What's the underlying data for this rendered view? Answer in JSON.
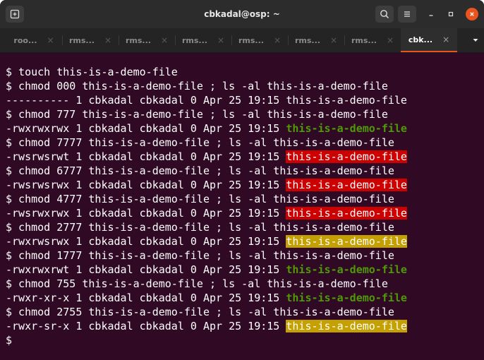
{
  "window": {
    "title": "cbkadal@osp: ~"
  },
  "tabs": [
    {
      "label": "roo...",
      "active": false
    },
    {
      "label": "rms...",
      "active": false
    },
    {
      "label": "rms...",
      "active": false
    },
    {
      "label": "rms...",
      "active": false
    },
    {
      "label": "rms...",
      "active": false
    },
    {
      "label": "rms...",
      "active": false
    },
    {
      "label": "rms...",
      "active": false
    },
    {
      "label": "cbk...",
      "active": true
    }
  ],
  "tab_close_glyph": "×",
  "icons": {
    "new_tab": "new-tab-icon",
    "search": "search-icon",
    "menu": "hamburger-menu-icon",
    "minimize": "minimize-icon",
    "maximize": "maximize-icon",
    "close": "close-icon",
    "tab_list": "chevron-down-icon"
  },
  "colors": {
    "terminal_bg": "#300a24",
    "titlebar_bg": "#2c2c2c",
    "tabbar_bg": "#242424",
    "close_button": "#e95420",
    "exec_file_green": "#4e9a06",
    "setuid_red_bg": "#cc0000",
    "setgid_yellow_bg": "#c4a000"
  },
  "terminal": {
    "lines": [
      [
        {
          "text": "$ touch this-is-a-demo-file",
          "style": "plain"
        }
      ],
      [
        {
          "text": "$ chmod 000 this-is-a-demo-file ; ls -al this-is-a-demo-file",
          "style": "plain"
        }
      ],
      [
        {
          "text": "---------- 1 cbkadal cbkadal 0 Apr 25 19:15 this-is-a-demo-file",
          "style": "plain"
        }
      ],
      [
        {
          "text": "$ chmod 777 this-is-a-demo-file ; ls -al this-is-a-demo-file",
          "style": "plain"
        }
      ],
      [
        {
          "text": "-rwxrwxrwx 1 cbkadal cbkadal 0 Apr 25 19:15 ",
          "style": "plain"
        },
        {
          "text": "this-is-a-demo-file",
          "style": "green"
        }
      ],
      [
        {
          "text": "$ chmod 7777 this-is-a-demo-file ; ls -al this-is-a-demo-file",
          "style": "plain"
        }
      ],
      [
        {
          "text": "-rwsrwsrwt 1 cbkadal cbkadal 0 Apr 25 19:15 ",
          "style": "plain"
        },
        {
          "text": "this-is-a-demo-file",
          "style": "red"
        }
      ],
      [
        {
          "text": "$ chmod 6777 this-is-a-demo-file ; ls -al this-is-a-demo-file",
          "style": "plain"
        }
      ],
      [
        {
          "text": "-rwsrwsrwx 1 cbkadal cbkadal 0 Apr 25 19:15 ",
          "style": "plain"
        },
        {
          "text": "this-is-a-demo-file",
          "style": "red"
        }
      ],
      [
        {
          "text": "$ chmod 4777 this-is-a-demo-file ; ls -al this-is-a-demo-file",
          "style": "plain"
        }
      ],
      [
        {
          "text": "-rwsrwxrwx 1 cbkadal cbkadal 0 Apr 25 19:15 ",
          "style": "plain"
        },
        {
          "text": "this-is-a-demo-file",
          "style": "red"
        }
      ],
      [
        {
          "text": "$ chmod 2777 this-is-a-demo-file ; ls -al this-is-a-demo-file",
          "style": "plain"
        }
      ],
      [
        {
          "text": "-rwxrwsrwx 1 cbkadal cbkadal 0 Apr 25 19:15 ",
          "style": "plain"
        },
        {
          "text": "this-is-a-demo-file",
          "style": "yellow"
        }
      ],
      [
        {
          "text": "$ chmod 1777 this-is-a-demo-file ; ls -al this-is-a-demo-file",
          "style": "plain"
        }
      ],
      [
        {
          "text": "-rwxrwxrwt 1 cbkadal cbkadal 0 Apr 25 19:15 ",
          "style": "plain"
        },
        {
          "text": "this-is-a-demo-file",
          "style": "green"
        }
      ],
      [
        {
          "text": "$ chmod 755 this-is-a-demo-file ; ls -al this-is-a-demo-file",
          "style": "plain"
        }
      ],
      [
        {
          "text": "-rwxr-xr-x 1 cbkadal cbkadal 0 Apr 25 19:15 ",
          "style": "plain"
        },
        {
          "text": "this-is-a-demo-file",
          "style": "green"
        }
      ],
      [
        {
          "text": "$ chmod 2755 this-is-a-demo-file ; ls -al this-is-a-demo-file",
          "style": "plain"
        }
      ],
      [
        {
          "text": "-rwxr-sr-x 1 cbkadal cbkadal 0 Apr 25 19:15 ",
          "style": "plain"
        },
        {
          "text": "this-is-a-demo-file",
          "style": "yellow"
        }
      ],
      [
        {
          "text": "$",
          "style": "plain"
        }
      ]
    ]
  }
}
